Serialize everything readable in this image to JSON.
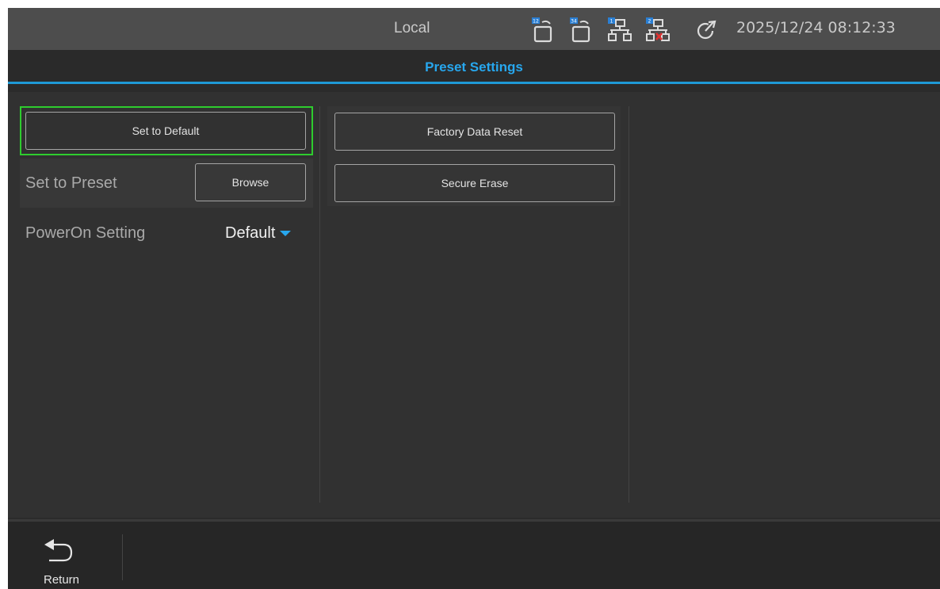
{
  "status": {
    "mode": "Local",
    "datetime": "2025/12/24 08:12:33",
    "icons": [
      {
        "name": "usb-port-12-icon",
        "badge": "12"
      },
      {
        "name": "usb-port-34-icon",
        "badge": "34"
      },
      {
        "name": "lan-1-icon",
        "badge": "1"
      },
      {
        "name": "lan-2-disconnected-icon",
        "badge": "2"
      },
      {
        "name": "refresh-icon"
      }
    ],
    "colors": {
      "badge": "#2a7fd4",
      "error": "#e03030"
    }
  },
  "title": "Preset Settings",
  "left": {
    "set_default_label": "Set to Default",
    "set_preset_label": "Set to Preset",
    "browse_label": "Browse",
    "poweron_label": "PowerOn Setting",
    "poweron_value": "Default"
  },
  "middle": {
    "factory_reset_label": "Factory Data Reset",
    "secure_erase_label": "Secure Erase"
  },
  "bottom": {
    "return_label": "Return"
  },
  "colors": {
    "accent": "#27a7ee",
    "focus": "#2ecc2e"
  }
}
